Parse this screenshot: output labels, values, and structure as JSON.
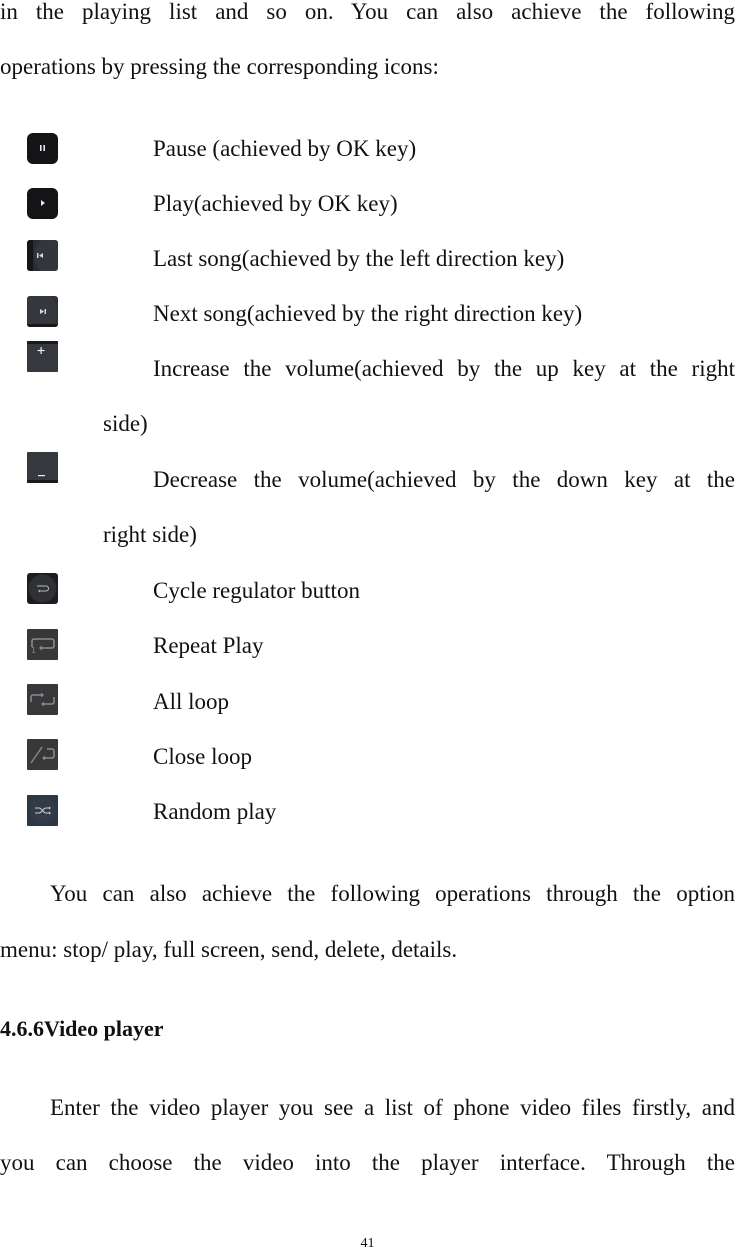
{
  "intro": {
    "line1": "in the playing list and so on. You can also achieve the following",
    "line2": "operations by pressing the corresponding icons:"
  },
  "icon_items": [
    {
      "icon": "pause-icon",
      "text": "Pause (achieved by OK key)"
    },
    {
      "icon": "play-icon",
      "text": "Play(achieved by OK key)"
    },
    {
      "icon": "previous-track-icon",
      "text": "Last song(achieved by the left direction key)"
    },
    {
      "icon": "next-track-icon",
      "text": "Next song(achieved by the right direction key)"
    },
    {
      "icon": "volume-up-icon",
      "text": "Increase the volume(achieved by the up key at the right",
      "continuation": "side)"
    },
    {
      "icon": "volume-down-icon",
      "text": "Decrease the volume(achieved by the down key at the",
      "continuation": "right side)"
    },
    {
      "icon": "cycle-regulator-icon",
      "text": "Cycle regulator button"
    },
    {
      "icon": "repeat-one-icon",
      "text": "Repeat Play"
    },
    {
      "icon": "repeat-all-icon",
      "text": "All loop"
    },
    {
      "icon": "loop-off-icon",
      "text": "Close loop"
    },
    {
      "icon": "shuffle-icon",
      "text": "Random play"
    }
  ],
  "option_menu": {
    "line1": "You can also achieve the following operations through the option",
    "line2": "menu: stop/ play, full screen, send, delete, details."
  },
  "section": {
    "heading": "4.6.6Video player",
    "line1": "Enter the video player you see a list of phone video files firstly, and",
    "line2": "you can choose the video into the player interface. Through the"
  },
  "page_number": "41"
}
